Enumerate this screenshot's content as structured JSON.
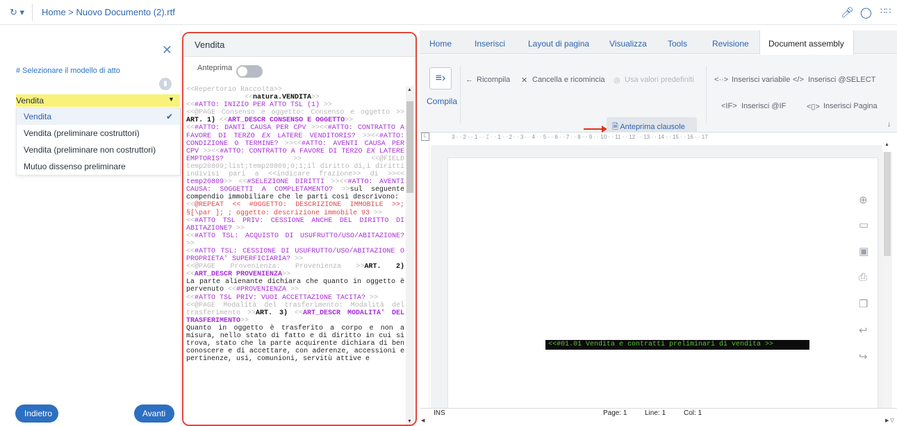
{
  "topbar": {
    "history_icon": "history-icon",
    "breadcrumb": "Home > Nuovo Documento (2).rtf",
    "icons": [
      "microphone-icon",
      "search-icon",
      "apps-grid-icon"
    ]
  },
  "left_panel": {
    "hint": "# Selezionare il modello di atto",
    "selected_value": "Vendita",
    "options": [
      {
        "label": "Vendita",
        "selected": true
      },
      {
        "label": "Vendita (preliminare costruttori)",
        "selected": false
      },
      {
        "label": "Vendita (preliminare non costruttori)",
        "selected": false
      },
      {
        "label": "Mutuo dissenso preliminare",
        "selected": false
      }
    ],
    "back_label": "Indietro",
    "next_label": "Avanti"
  },
  "middle_panel": {
    "title": "Vendita",
    "preview_label": "Anteprima",
    "preview_on": false
  },
  "ribbon": {
    "tabs": [
      "Home",
      "Inserisci",
      "Layout di pagina",
      "Visualizza",
      "Tools",
      "Revisione",
      "Document assembly"
    ],
    "active_tab": "Document assembly",
    "compile": "Compila",
    "recompile": "Ricompila",
    "cancel_restart": "Cancella e ricomincia",
    "use_defaults": "Usa valori predefiniti",
    "preview_clauses": "Anteprima clausole",
    "insert_variable": "Inserisci variabile",
    "insert_select": "Inserisci @SELECT",
    "insert_if": "Inserisci @IF",
    "insert_page": "Inserisci Pagina"
  },
  "document": {
    "black_bar_text": "<<#01.01   Vendita e contratti preliminari di vendita >>"
  },
  "status": {
    "mode": "INS",
    "page": "Page: 1",
    "line": "Line: 1",
    "col": "Col: 1"
  }
}
